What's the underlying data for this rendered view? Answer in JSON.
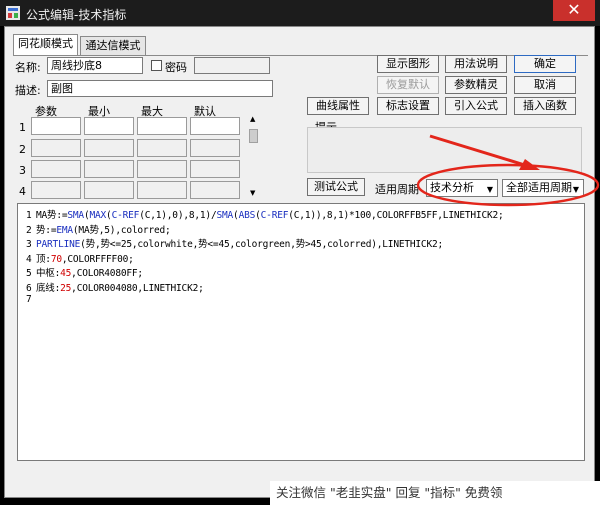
{
  "window": {
    "title": "公式编辑-技术指标",
    "close_glyph": "✕"
  },
  "tabs": [
    {
      "label": "同花顺模式",
      "active": true
    },
    {
      "label": "通达信模式",
      "active": false
    }
  ],
  "form": {
    "name_label": "名称:",
    "name_value": "周线抄底8",
    "password_label": "密码",
    "desc_label": "描述:",
    "desc_value": "副图"
  },
  "params": {
    "headers": [
      "参数",
      "最小",
      "最大",
      "默认"
    ],
    "rows": [
      "1",
      "2",
      "3",
      "4"
    ]
  },
  "buttons": {
    "show_graph": "显示图形",
    "usage": "用法说明",
    "ok": "确定",
    "restore_default": "恢复默认",
    "param_tuning": "参数精灵",
    "cancel": "取消",
    "curve_props": "曲线属性",
    "mark_settings": "标志设置",
    "import_formula": "引入公式",
    "insert_function": "插入函数",
    "test_formula": "测试公式"
  },
  "hint": {
    "label": "提示"
  },
  "period": {
    "label": "适用周期",
    "category_value": "技术分析",
    "period_value": "全部适用周期"
  },
  "code": {
    "lines": [
      {
        "no": "1",
        "segments": [
          {
            "t": "MA势:=",
            "c": ""
          },
          {
            "t": "SMA",
            "c": "blue"
          },
          {
            "t": "(",
            "c": ""
          },
          {
            "t": "MAX",
            "c": "blue"
          },
          {
            "t": "(",
            "c": ""
          },
          {
            "t": "C-REF",
            "c": "blue"
          },
          {
            "t": "(C,1),0),8,1)/",
            "c": ""
          },
          {
            "t": "SMA",
            "c": "blue"
          },
          {
            "t": "(",
            "c": ""
          },
          {
            "t": "ABS",
            "c": "blue"
          },
          {
            "t": "(",
            "c": ""
          },
          {
            "t": "C-REF",
            "c": "blue"
          },
          {
            "t": "(C,1)),8,1)*100,COLORFFB5FF,LINETHICK2;",
            "c": ""
          }
        ]
      },
      {
        "no": "2",
        "segments": [
          {
            "t": "势:=",
            "c": ""
          },
          {
            "t": "EMA",
            "c": "blue"
          },
          {
            "t": "(MA势,5),colorred;",
            "c": ""
          }
        ]
      },
      {
        "no": "3",
        "segments": [
          {
            "t": "PARTLINE",
            "c": "blue"
          },
          {
            "t": "(势,势<=25,colorwhite,势<=45,colorgreen,势>45,colorred),LINETHICK2;",
            "c": ""
          }
        ]
      },
      {
        "no": "4",
        "segments": [
          {
            "t": "顶:",
            "c": ""
          },
          {
            "t": "70",
            "c": "red"
          },
          {
            "t": ",COLORFFFF00;",
            "c": ""
          }
        ]
      },
      {
        "no": "5",
        "segments": [
          {
            "t": "中枢:",
            "c": ""
          },
          {
            "t": "45",
            "c": "red"
          },
          {
            "t": ",COLOR4080FF;",
            "c": ""
          }
        ]
      },
      {
        "no": "6",
        "segments": [
          {
            "t": "底线:",
            "c": ""
          },
          {
            "t": "25",
            "c": "red"
          },
          {
            "t": ",COLOR004080,LINETHICK2;",
            "c": ""
          }
        ]
      },
      {
        "no": "7",
        "segments": []
      }
    ]
  },
  "watermark": {
    "text": "关注微信 \"老韭实盘\" 回复 \"指标\" 免费领"
  },
  "colors": {
    "annotation_red": "#e3261b",
    "keyword_blue": "#1a2fbf",
    "number_red": "#d00000"
  }
}
